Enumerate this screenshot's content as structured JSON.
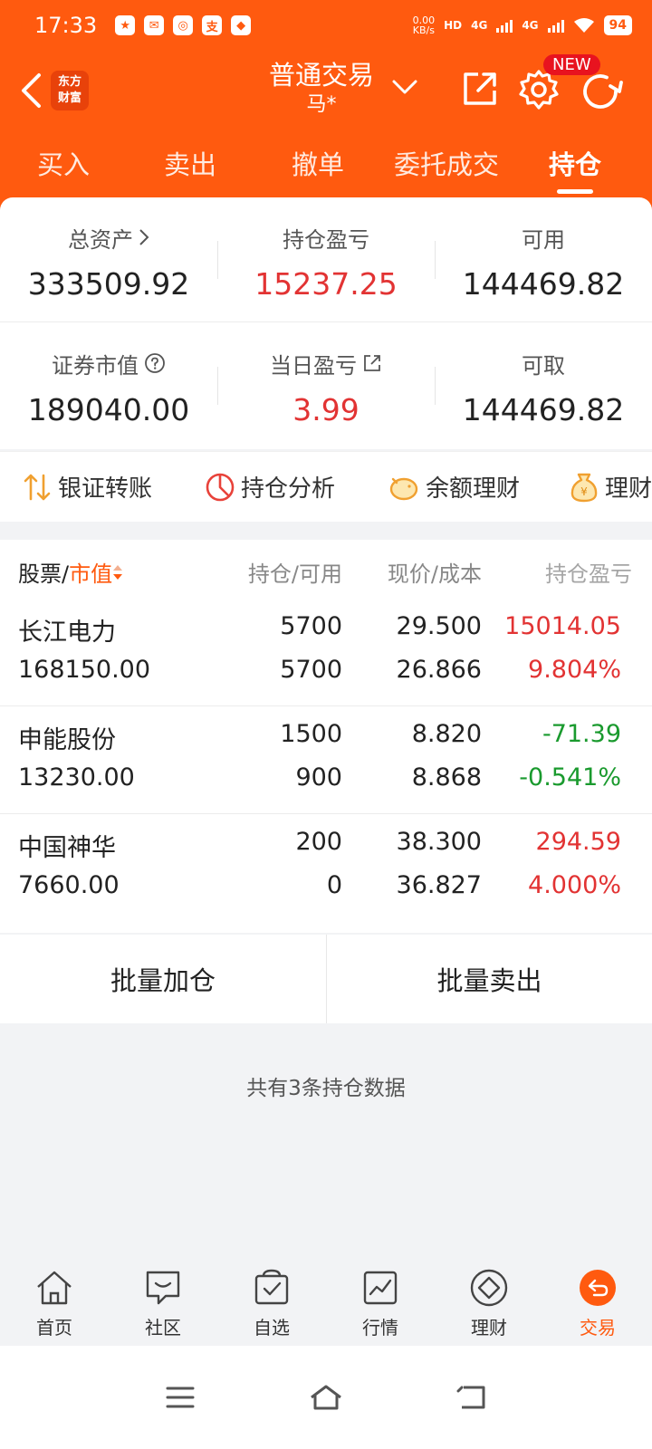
{
  "status_bar": {
    "time": "17:33",
    "net_speed_value": "0.00",
    "net_speed_unit": "KB/s",
    "hd_label": "HD",
    "sim1": "4G",
    "sim2": "4G",
    "battery": "94",
    "app_icons": [
      "notification-app-icon",
      "mail-icon",
      "app-icon",
      "alipay-icon",
      "browser-icon"
    ]
  },
  "nav": {
    "brand_line1": "东方",
    "brand_line2": "财富",
    "title": "普通交易",
    "subtitle": "马*",
    "new_badge": "NEW"
  },
  "tabs": [
    {
      "label": "买入",
      "active": false
    },
    {
      "label": "卖出",
      "active": false
    },
    {
      "label": "撤单",
      "active": false
    },
    {
      "label": "委托成交",
      "active": false
    },
    {
      "label": "持仓",
      "active": true
    }
  ],
  "summary": {
    "total_assets_label": "总资产",
    "total_assets_value": "333509.92",
    "position_pl_label": "持仓盈亏",
    "position_pl_value": "15237.25",
    "available_label": "可用",
    "available_value": "144469.82",
    "market_value_label": "证券市值",
    "market_value_value": "189040.00",
    "daily_pl_label": "当日盈亏",
    "daily_pl_value": "3.99",
    "withdrawable_label": "可取",
    "withdrawable_value": "144469.82"
  },
  "quick_actions": [
    {
      "label": "银证转账",
      "icon": "transfer-icon"
    },
    {
      "label": "持仓分析",
      "icon": "pie-chart-icon"
    },
    {
      "label": "余额理财",
      "icon": "piggy-bank-icon"
    },
    {
      "label": "理财",
      "icon": "money-bag-icon"
    }
  ],
  "table": {
    "head_stock": "股票/",
    "head_sort": "市值",
    "head_position": "持仓/可用",
    "head_price": "现价/成本",
    "head_pl": "持仓盈亏",
    "rows": [
      {
        "name": "长江电力",
        "market_value": "168150.00",
        "position": "5700",
        "available": "5700",
        "price": "29.500",
        "cost": "26.866",
        "pl": "15014.05",
        "pl_pct": "9.804%",
        "trend": "up"
      },
      {
        "name": "申能股份",
        "market_value": "13230.00",
        "position": "1500",
        "available": "900",
        "price": "8.820",
        "cost": "8.868",
        "pl": "-71.39",
        "pl_pct": "-0.541%",
        "trend": "down"
      },
      {
        "name": "中国神华",
        "market_value": "7660.00",
        "position": "200",
        "available": "0",
        "price": "38.300",
        "cost": "36.827",
        "pl": "294.59",
        "pl_pct": "4.000%",
        "trend": "up"
      }
    ]
  },
  "batch": {
    "add_label": "批量加仓",
    "sell_label": "批量卖出"
  },
  "count_text": "共有3条持仓数据",
  "bottom_nav": [
    {
      "label": "首页",
      "icon": "home-icon",
      "active": false
    },
    {
      "label": "社区",
      "icon": "community-icon",
      "active": false
    },
    {
      "label": "自选",
      "icon": "watchlist-icon",
      "active": false
    },
    {
      "label": "行情",
      "icon": "market-icon",
      "active": false
    },
    {
      "label": "理财",
      "icon": "wealth-icon",
      "active": false
    },
    {
      "label": "交易",
      "icon": "trade-icon",
      "active": true
    }
  ],
  "colors": {
    "brand_orange": "#ff5a0f",
    "up_red": "#e23333",
    "down_green": "#1a9a2e"
  }
}
